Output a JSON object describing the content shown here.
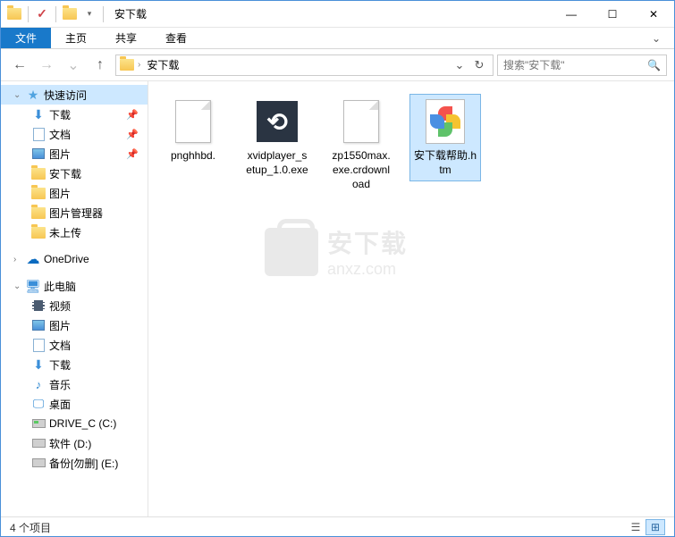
{
  "title": "安下载",
  "ribbon": {
    "file": "文件",
    "home": "主页",
    "share": "共享",
    "view": "查看"
  },
  "nav": {
    "dropdown_caret": "⌄"
  },
  "address": {
    "crumb": "安下载"
  },
  "search": {
    "placeholder": "搜索\"安下载\""
  },
  "sidebar": {
    "quick": "快速访问",
    "downloads": "下载",
    "documents": "文档",
    "pictures": "图片",
    "anxiazai": "安下载",
    "pictures2": "图片",
    "picmanager": "图片管理器",
    "unuploaded": "未上传",
    "onedrive": "OneDrive",
    "thispc": "此电脑",
    "videos": "视频",
    "pictures3": "图片",
    "documents2": "文档",
    "downloads2": "下载",
    "music": "音乐",
    "desktop": "桌面",
    "drive_c": "DRIVE_C (C:)",
    "drive_d": "软件 (D:)",
    "drive_e": "备份[勿删] (E:)"
  },
  "files": [
    {
      "name": "pnghhbd.",
      "type": "blank"
    },
    {
      "name": "xvidplayer_setup_1.0.exe",
      "type": "xvid"
    },
    {
      "name": "zp1550max.exe.crdownload",
      "type": "blank"
    },
    {
      "name": "安下载帮助.htm",
      "type": "htm"
    }
  ],
  "watermark": {
    "cn": "安下载",
    "en": "anxz.com"
  },
  "status": {
    "count": "4 个项目"
  }
}
